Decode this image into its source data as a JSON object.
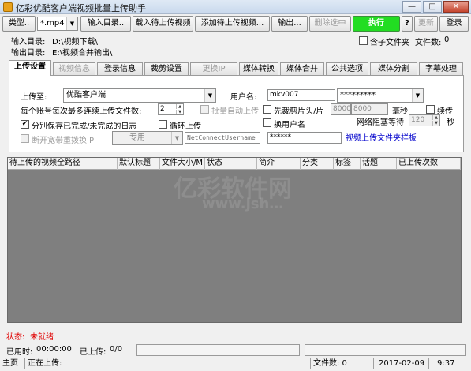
{
  "window": {
    "title": "亿彩优酷客户端视频批量上传助手"
  },
  "toolbar": {
    "type_label": "类型..",
    "type_value": "*.mp4",
    "input_dir_btn": "输入目录..",
    "load_btn": "载入待上传视频",
    "add_btn": "添加待上传视频...",
    "output_btn": "输出...",
    "delete_btn": "删除选中",
    "run_btn": "执行",
    "help_btn": "?",
    "update_btn": "更新",
    "login_btn": "登录"
  },
  "dirs": {
    "input_label": "输入目录:",
    "input_value": "D:\\视频下载\\",
    "output_label": "输出目录:",
    "output_value": "E:\\视频合并输出\\",
    "subfolder_label": "含子文件夹",
    "file_count_label": "文件数:",
    "file_count_value": "0"
  },
  "tabs": [
    "上传设置",
    "视频信息",
    "登录信息",
    "裁剪设置",
    "更换IP",
    "媒体转换",
    "媒体合并",
    "公共选项",
    "媒体分割",
    "字幕处理"
  ],
  "upload": {
    "upload_to_label": "上传至:",
    "upload_to_value": "优酷客户端",
    "username_label": "用户名:",
    "username_value": "mkv007",
    "password_value": "*********",
    "per_account_label": "每个账号每次最多连续上传文件数:",
    "per_account_value": "2",
    "batch_auto_label": "批量自动上传",
    "trim_label": "先裁剪片头/片",
    "trim_head": "8000",
    "trim_tail": "8000",
    "ms_label": "毫秒",
    "resume_label": "续传",
    "save_log_label": "分别保存已完成/未完成的日志",
    "loop_label": "循环上传",
    "switch_user_label": "换用户名",
    "net_block_label": "网络阻塞等待",
    "net_block_value": "120",
    "sec_label": "秒",
    "disconnect_label": "断开宽带重拨换IP",
    "dial_type": "专用",
    "net_username_placeholder": "NetConnectUsername",
    "net_password": "******",
    "sample_link": "视频上传文件夹样板"
  },
  "table": {
    "columns": [
      "待上传的视频全路径",
      "默认标题",
      "文件大小/M",
      "状态",
      "简介",
      "分类",
      "标签",
      "话题",
      "已上传次数"
    ],
    "rows": []
  },
  "watermark": {
    "line1": "亿彩软件网",
    "line2": "www.jsh…"
  },
  "status": {
    "state_label": "状态:",
    "state_value": "未就绪",
    "elapsed_label": "已用时:",
    "elapsed_value": "00:00:00",
    "uploaded_label": "已上传:",
    "uploaded_value": "0/0"
  },
  "statusbar": {
    "home": "主页",
    "uploading_label": "正在上传:",
    "file_count": "文件数: 0",
    "date": "2017-02-09",
    "time": "9:37"
  },
  "colors": {
    "run_green": "#22dd22",
    "status_red": "#e00000",
    "link_blue": "#0000cc",
    "grid_bg": "#7f7f7f"
  }
}
